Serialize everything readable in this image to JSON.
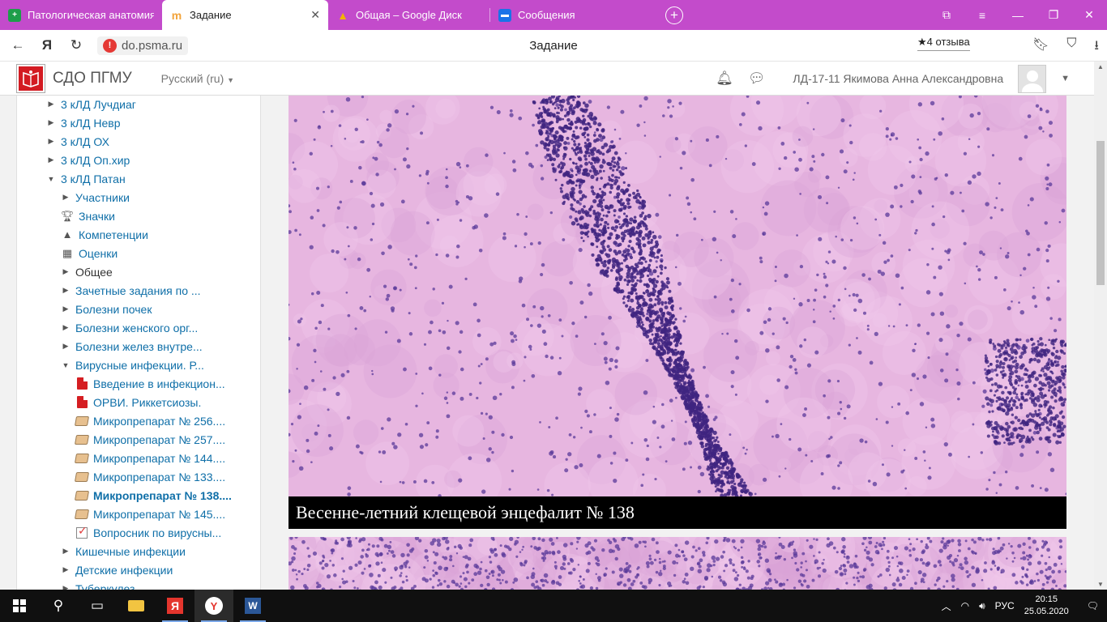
{
  "browser": {
    "tabs": [
      {
        "title": "Патологическая анатомия",
        "favicon_color": "#1e9e4a",
        "favicon_glyph": "plus-icon",
        "active": false
      },
      {
        "title": "Задание",
        "favicon_color": "#f2a33a",
        "favicon_glyph": "moodle-icon",
        "active": true
      },
      {
        "title": "Общая – Google Диск",
        "favicon_color": "#f4b400",
        "favicon_glyph": "drive-icon",
        "active": false
      },
      {
        "title": "Сообщения",
        "favicon_color": "#1a73e8",
        "favicon_glyph": "chat-icon",
        "active": false
      }
    ],
    "url": "do.psma.ru",
    "page_title": "Задание",
    "reviews": "★4 отзыва"
  },
  "moodle": {
    "brand": "СДО ПГМУ",
    "language": "Русский (ru)",
    "username": "ЛД-17-11 Якимова Анна Александровна"
  },
  "sidebar": {
    "items": [
      {
        "label": "3 кЛД Лучдиаг",
        "indent": 0,
        "icon": "triangle-right",
        "style": "link"
      },
      {
        "label": "3 кЛД Невр",
        "indent": 0,
        "icon": "triangle-right",
        "style": "link"
      },
      {
        "label": "3 кЛД ОХ",
        "indent": 0,
        "icon": "triangle-right",
        "style": "link"
      },
      {
        "label": "3 кЛД Оп.хир",
        "indent": 0,
        "icon": "triangle-right",
        "style": "link"
      },
      {
        "label": "3 кЛД Патан",
        "indent": 0,
        "icon": "triangle-down",
        "style": "link"
      },
      {
        "label": "Участники",
        "indent": 1,
        "icon": "triangle-right",
        "style": "link"
      },
      {
        "label": "Значки",
        "indent": 1,
        "icon": "trophy",
        "style": "link"
      },
      {
        "label": "Компетенции",
        "indent": 1,
        "icon": "competency",
        "style": "link"
      },
      {
        "label": "Оценки",
        "indent": 1,
        "icon": "grades",
        "style": "link"
      },
      {
        "label": "Общее",
        "indent": 1,
        "icon": "triangle-right",
        "style": "dark"
      },
      {
        "label": "Зачетные задания по ...",
        "indent": 1,
        "icon": "triangle-right",
        "style": "link"
      },
      {
        "label": "Болезни почек",
        "indent": 1,
        "icon": "triangle-right",
        "style": "link"
      },
      {
        "label": "Болезни женского орг...",
        "indent": 1,
        "icon": "triangle-right",
        "style": "link"
      },
      {
        "label": "Болезни желез внутре...",
        "indent": 1,
        "icon": "triangle-right",
        "style": "link"
      },
      {
        "label": "Вирусные инфекции. Р...",
        "indent": 1,
        "icon": "triangle-down",
        "style": "link"
      },
      {
        "label": "Введение в инфекцион...",
        "indent": 2,
        "icon": "pdf",
        "style": "link"
      },
      {
        "label": "ОРВИ. Риккетсиозы.",
        "indent": 2,
        "icon": "pdf",
        "style": "link"
      },
      {
        "label": "Микропрепарат № 256....",
        "indent": 2,
        "icon": "lesson",
        "style": "link"
      },
      {
        "label": "Микропрепарат № 257....",
        "indent": 2,
        "icon": "lesson",
        "style": "link"
      },
      {
        "label": "Микропрепарат № 144....",
        "indent": 2,
        "icon": "lesson",
        "style": "link"
      },
      {
        "label": "Микропрепарат № 133....",
        "indent": 2,
        "icon": "lesson",
        "style": "link"
      },
      {
        "label": "Микропрепарат № 138....",
        "indent": 2,
        "icon": "lesson",
        "style": "bold"
      },
      {
        "label": "Микропрепарат № 145....",
        "indent": 2,
        "icon": "lesson",
        "style": "link"
      },
      {
        "label": "Вопросник по вирусны...",
        "indent": 2,
        "icon": "quiz",
        "style": "link"
      },
      {
        "label": "Кишечные инфекции",
        "indent": 1,
        "icon": "triangle-right",
        "style": "link"
      },
      {
        "label": "Детские инфекции",
        "indent": 1,
        "icon": "triangle-right",
        "style": "link"
      },
      {
        "label": "Туберкулез",
        "indent": 1,
        "icon": "triangle-right",
        "style": "link"
      }
    ]
  },
  "content": {
    "caption": "Весенне-летний клещевой энцефалит № 138"
  },
  "taskbar": {
    "language": "РУС",
    "time": "20:15",
    "date": "25.05.2020"
  },
  "colors": {
    "tab_strip": "#c34bcb",
    "link": "#0f6fa8",
    "stain_pink": "#e9b9e0",
    "stain_purple": "#4b2a8c"
  }
}
